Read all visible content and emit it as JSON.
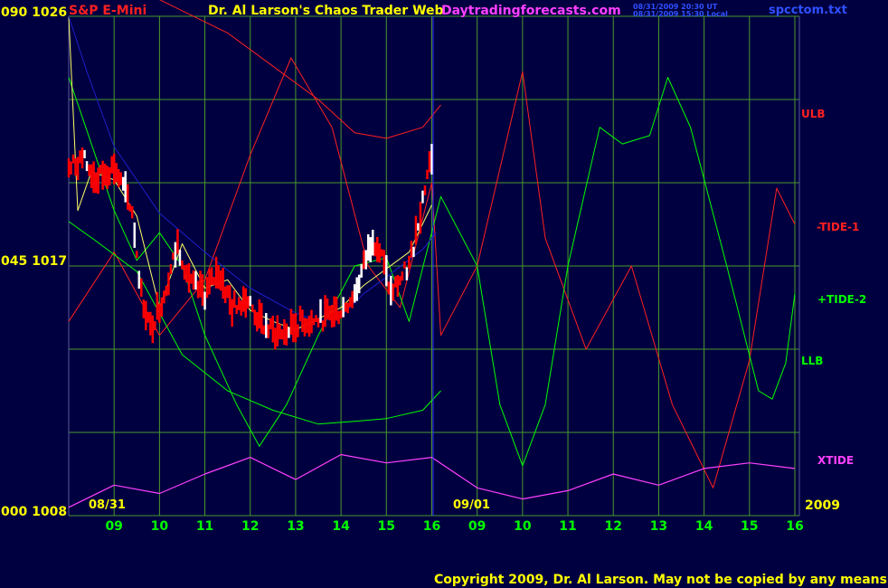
{
  "header": {
    "yaxis_top_label": "090  1026",
    "symbol": "S&P E-Mini",
    "title": "Dr. Al Larson's Chaos Trader Web",
    "site": "Daytradingforecasts.com",
    "time_ut": "08/31/2009 20:30 UT",
    "time_local": "08/31/2009 15:30 Local",
    "file": "spcctom.txt"
  },
  "y_labels": {
    "top": "090  1026",
    "mid": "045  1017",
    "bottom": "000  1008"
  },
  "x_labels": [
    "09",
    "10",
    "11",
    "12",
    "13",
    "14",
    "15",
    "16",
    "09",
    "10",
    "11",
    "12",
    "13",
    "14",
    "15",
    "16"
  ],
  "date_labels": {
    "first": "08/31",
    "second": "09/01",
    "year": "2009"
  },
  "legend": [
    {
      "key": "ulb",
      "text": "ULB",
      "color": "#ff2020"
    },
    {
      "key": "tide1",
      "text": "-TIDE-1",
      "color": "#ff2020"
    },
    {
      "key": "tide2",
      "text": "+TIDE-2",
      "color": "#00ff00"
    },
    {
      "key": "llb",
      "text": "LLB",
      "color": "#00ff00"
    },
    {
      "key": "xtide",
      "text": "XTIDE",
      "color": "#ff40ff"
    }
  ],
  "copyright": "Copyright 2009, Dr. Al Larson. May not be copied by any means.",
  "colors": {
    "background": "#000040",
    "grid": "#4a9a2a",
    "axis_text": "#ffff00",
    "hour_text": "#00ff00",
    "cursor": "#3030ff",
    "price_up": "#ffffff",
    "price_down": "#ff0000"
  },
  "chart_data": {
    "type": "line",
    "title": "S&P E-Mini",
    "x_unit": "hour",
    "x_range": [
      8.0,
      24.1
    ],
    "y_range": [
      1008,
      1026
    ],
    "y_ticks": [
      1008,
      1017,
      1026
    ],
    "series": [
      {
        "name": "ULB",
        "color": "#ff2020",
        "x": [
          8.0,
          8.8,
          9.5,
          10.5,
          11.5,
          12.5,
          13.5,
          14.3,
          15.0,
          15.8,
          16.2
        ],
        "y": [
          1032,
          1029,
          1027,
          1026.2,
          1025.4,
          1024.2,
          1023.0,
          1021.8,
          1021.6,
          1022.0,
          1022.8
        ]
      },
      {
        "name": "-TIDE-1",
        "color": "#ff2020",
        "x": [
          8.0,
          9.0,
          10.0,
          11.0,
          12.0,
          12.9,
          13.8,
          14.6,
          15.3,
          16.0,
          16.2,
          17.0,
          18.0,
          18.5,
          19.4,
          20.4,
          21.3,
          22.2,
          23.0,
          23.6,
          24.0
        ],
        "y": [
          1015,
          1017.5,
          1014.5,
          1016.5,
          1021,
          1024.5,
          1022,
          1017,
          1015.5,
          1020,
          1014.5,
          1017,
          1024,
          1018,
          1014,
          1017,
          1012,
          1009,
          1013.6,
          1019.8,
          1018.5
        ]
      },
      {
        "name": "+TIDE-2",
        "color": "#00ff00",
        "x": [
          8.0,
          9.0,
          9.5,
          10.0,
          10.5,
          11.0,
          11.7,
          12.2,
          12.8,
          13.5,
          14.3,
          15.0,
          15.5,
          16.2,
          17.0,
          17.5,
          18.0,
          18.5,
          19.0,
          19.7,
          20.2,
          20.8,
          21.2,
          21.7,
          22.5,
          23.2,
          23.5,
          23.8,
          24.0
        ],
        "y": [
          1023.8,
          1019,
          1017.2,
          1018.2,
          1017.0,
          1014.5,
          1012,
          1010.5,
          1012,
          1014.5,
          1017.0,
          1017.3,
          1015,
          1019.5,
          1017,
          1012,
          1009.8,
          1012,
          1017,
          1022,
          1021.4,
          1021.7,
          1023.8,
          1022,
          1017,
          1012.5,
          1012.2,
          1013.5,
          1016
        ]
      },
      {
        "name": "LLB",
        "color": "#00ff00",
        "x": [
          8.0,
          8.6,
          9.5,
          10.5,
          11.5,
          12.5,
          13.5,
          14.3,
          15.0,
          15.8,
          16.2
        ],
        "y": [
          1018.6,
          1017.9,
          1016.8,
          1013.8,
          1012.5,
          1011.8,
          1011.3,
          1011.4,
          1011.5,
          1011.8,
          1012.5
        ]
      },
      {
        "name": "XTIDE",
        "color": "#ff40ff",
        "x": [
          8.0,
          9.0,
          10.0,
          11.0,
          12.0,
          13.0,
          14.0,
          15.0,
          16.0,
          17.0,
          18.0,
          19.0,
          20.0,
          21.0,
          22.0,
          23.0,
          24.0
        ],
        "y": [
          1008.3,
          1009.1,
          1008.8,
          1009.5,
          1010.1,
          1009.3,
          1010.2,
          1009.9,
          1010.1,
          1009.0,
          1008.6,
          1008.9,
          1009.5,
          1009.1,
          1009.7,
          1009.9,
          1009.7
        ]
      },
      {
        "name": "Average",
        "color": "#ffff66",
        "x": [
          8.0,
          8.2,
          8.5,
          9.0,
          9.5,
          10.0,
          10.5,
          11.0,
          11.5,
          12.0,
          12.5,
          13.0,
          13.5,
          14.0,
          14.5,
          15.0,
          15.5,
          16.0
        ],
        "y": [
          1026,
          1019,
          1020.4,
          1020.1,
          1018.8,
          1015.5,
          1017.8,
          1016.2,
          1016.5,
          1015.4,
          1015.0,
          1014.7,
          1015.1,
          1015.5,
          1016.3,
          1016.9,
          1017.5,
          1019.2
        ]
      },
      {
        "name": "Blue",
        "color": "#1e1ec8",
        "x": [
          8.0,
          8.4,
          9.0,
          10.0,
          11.0,
          12.0,
          13.0,
          13.5,
          14.0,
          14.5,
          15.0,
          15.8,
          16.1
        ],
        "y": [
          1026,
          1024,
          1021.3,
          1018.9,
          1017.5,
          1016.2,
          1015.3,
          1015.0,
          1015.2,
          1016.0,
          1016.6,
          1017.6,
          1018.2
        ]
      },
      {
        "name": "Price",
        "color": "#ff0000",
        "x": [
          8.0,
          8.3,
          8.6,
          9.0,
          9.4,
          9.6,
          9.8,
          10.1,
          10.4,
          10.7,
          11.0,
          11.3,
          11.6,
          11.9,
          12.2,
          12.5,
          12.8,
          13.1,
          13.4,
          13.7,
          14.0,
          14.3,
          14.5,
          14.7,
          14.9,
          15.1,
          15.3,
          15.5,
          15.7,
          15.9,
          16.05
        ],
        "y": [
          1020.5,
          1020.9,
          1020.1,
          1020.6,
          1019.0,
          1016.0,
          1014.7,
          1016.0,
          1017.8,
          1016.3,
          1016.0,
          1016.8,
          1015.5,
          1015.9,
          1015.0,
          1014.6,
          1014.6,
          1015.0,
          1015.0,
          1015.2,
          1015.4,
          1016.0,
          1017.0,
          1018.1,
          1017.3,
          1016.0,
          1016.5,
          1017.0,
          1018.6,
          1020.3,
          1021.3
        ]
      }
    ]
  }
}
